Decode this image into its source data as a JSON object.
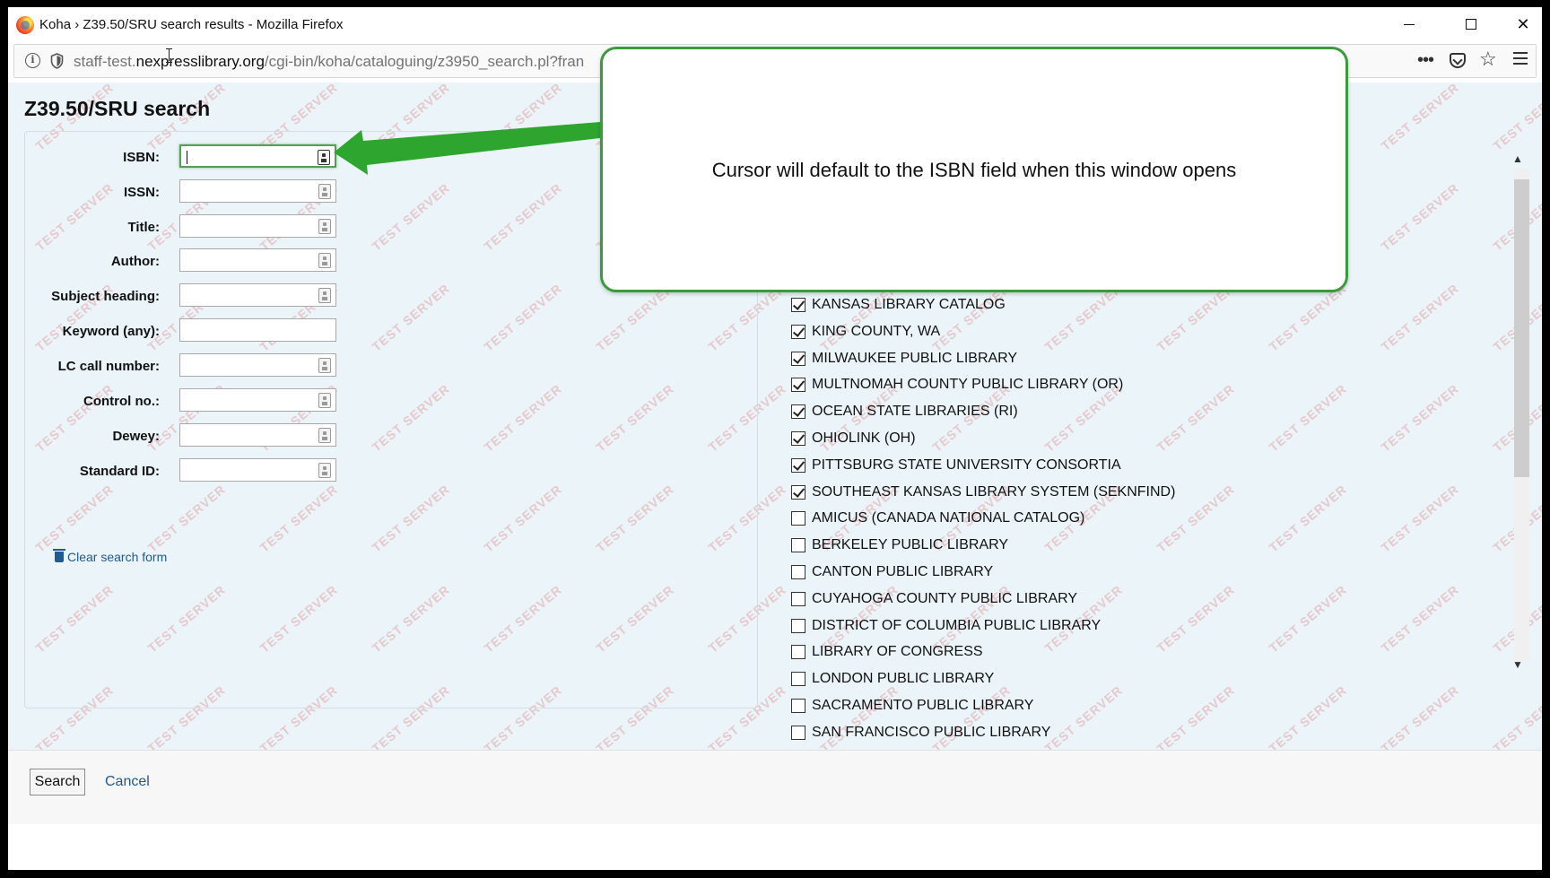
{
  "window": {
    "title": "Koha › Z39.50/SRU search results - Mozilla Firefox"
  },
  "urlbar": {
    "prefix": "staff-test.",
    "domain": "nexpresslibrary.org",
    "path": "/cgi-bin/koha/cataloguing/z3950_search.pl?fran"
  },
  "page": {
    "title": "Z39.50/SRU search",
    "watermark": "TEST SERVER"
  },
  "form": {
    "fields": [
      {
        "label": "ISBN:",
        "value": "",
        "focused": true,
        "keyboard_icon": true
      },
      {
        "label": "ISSN:",
        "value": "",
        "focused": false,
        "keyboard_icon": true
      },
      {
        "label": "Title:",
        "value": "",
        "focused": false,
        "keyboard_icon": true
      },
      {
        "label": "Author:",
        "value": "",
        "focused": false,
        "keyboard_icon": true
      },
      {
        "label": "Subject heading:",
        "value": "",
        "focused": false,
        "keyboard_icon": true
      },
      {
        "label": "Keyword (any):",
        "value": "",
        "focused": false,
        "keyboard_icon": false
      },
      {
        "label": "LC call number:",
        "value": "",
        "focused": false,
        "keyboard_icon": true
      },
      {
        "label": "Control no.:",
        "value": "",
        "focused": false,
        "keyboard_icon": true
      },
      {
        "label": "Dewey:",
        "value": "",
        "focused": false,
        "keyboard_icon": true
      },
      {
        "label": "Standard ID:",
        "value": "",
        "focused": false,
        "keyboard_icon": true
      }
    ],
    "clear_label": "Clear search form"
  },
  "servers": [
    {
      "name": "KANSAS LIBRARY CATALOG",
      "checked": true
    },
    {
      "name": "KING COUNTY, WA",
      "checked": true
    },
    {
      "name": "MILWAUKEE PUBLIC LIBRARY",
      "checked": true
    },
    {
      "name": "MULTNOMAH COUNTY PUBLIC LIBRARY (OR)",
      "checked": true
    },
    {
      "name": "OCEAN STATE LIBRARIES (RI)",
      "checked": true
    },
    {
      "name": "OHIOLINK (OH)",
      "checked": true
    },
    {
      "name": "PITTSBURG STATE UNIVERSITY CONSORTIA",
      "checked": true
    },
    {
      "name": "SOUTHEAST KANSAS LIBRARY SYSTEM (SEKNFIND)",
      "checked": true
    },
    {
      "name": "AMICUS (CANADA NATIONAL CATALOG)",
      "checked": false
    },
    {
      "name": "BERKELEY PUBLIC LIBRARY",
      "checked": false
    },
    {
      "name": "CANTON PUBLIC LIBRARY",
      "checked": false
    },
    {
      "name": "CUYAHOGA COUNTY PUBLIC LIBRARY",
      "checked": false
    },
    {
      "name": "DISTRICT OF COLUMBIA PUBLIC LIBRARY",
      "checked": false
    },
    {
      "name": "LIBRARY OF CONGRESS",
      "checked": false
    },
    {
      "name": "LONDON PUBLIC LIBRARY",
      "checked": false
    },
    {
      "name": "SACRAMENTO PUBLIC LIBRARY",
      "checked": false
    },
    {
      "name": "SAN FRANCISCO PUBLIC LIBRARY",
      "checked": false
    }
  ],
  "footer": {
    "search_label": "Search",
    "cancel_label": "Cancel"
  },
  "callout": {
    "text": "Cursor will default to the ISBN field when this window opens"
  },
  "colors": {
    "page_bg": "#eaf4f9",
    "link": "#1f5a93",
    "callout_border": "#3b9b3b",
    "watermark": "#dc5a5a"
  }
}
